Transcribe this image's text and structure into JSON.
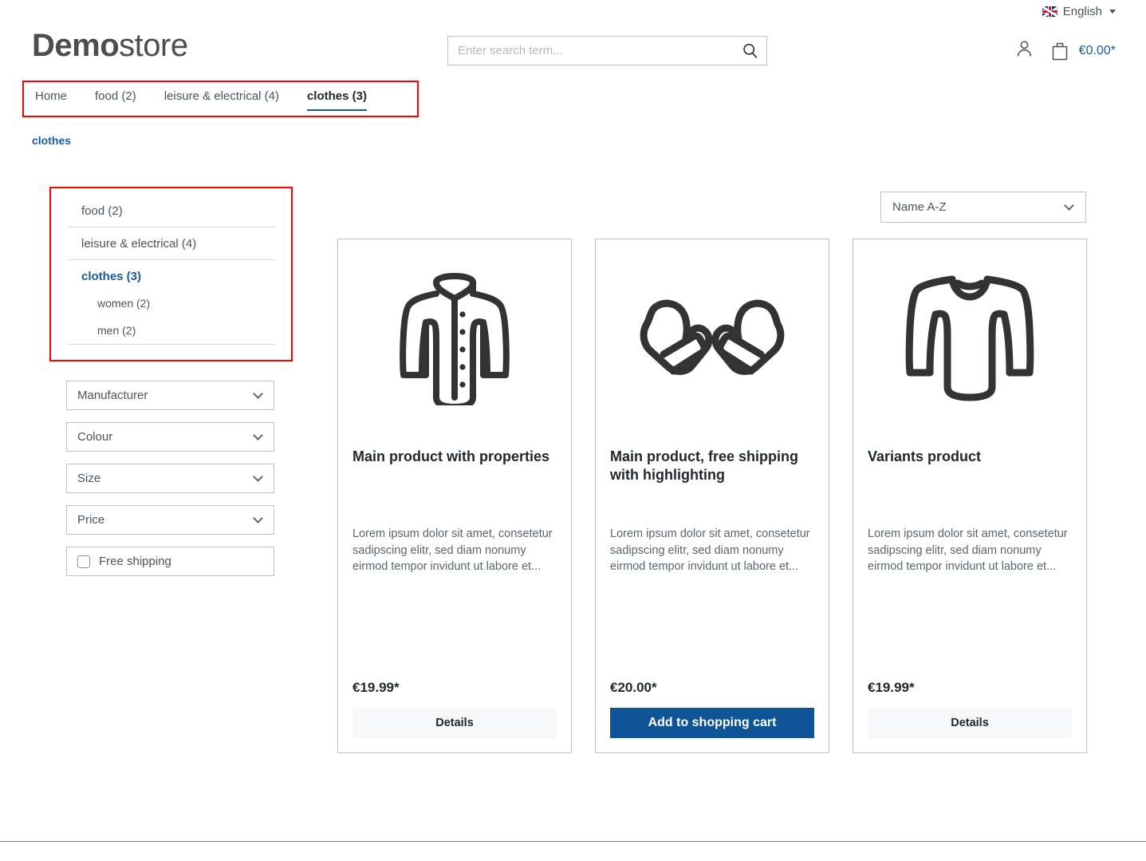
{
  "topbar": {
    "flag_icon": "uk-flag-icon",
    "language": "English",
    "caret_icon": "chevron-down-icon"
  },
  "header": {
    "logo_bold": "Demo",
    "logo_light": "store",
    "search": {
      "placeholder": "Enter search term...",
      "value": "",
      "icon": "search-icon"
    },
    "account_icon": "user-icon",
    "cart_icon": "shopping-bag-icon",
    "cart_total": "€0.00*"
  },
  "mainnav": {
    "items": [
      {
        "label": "Home",
        "active": false
      },
      {
        "label": "food (2)",
        "active": false
      },
      {
        "label": "leisure & electrical (4)",
        "active": false
      },
      {
        "label": "clothes (3)",
        "active": true
      }
    ]
  },
  "breadcrumb": {
    "label": "clothes"
  },
  "sidebar": {
    "categories": [
      {
        "label": "food (2)",
        "level": "top",
        "active": false
      },
      {
        "label": "leisure & electrical (4)",
        "level": "top",
        "active": false
      },
      {
        "label": "clothes (3)",
        "level": "top",
        "active": true
      },
      {
        "label": "women (2)",
        "level": "sub",
        "active": false
      },
      {
        "label": "men (2)",
        "level": "sub",
        "active": false
      }
    ],
    "filters": [
      {
        "label": "Manufacturer",
        "icon": "chevron-down-icon"
      },
      {
        "label": "Colour",
        "icon": "chevron-down-icon"
      },
      {
        "label": "Size",
        "icon": "chevron-down-icon"
      },
      {
        "label": "Price",
        "icon": "chevron-down-icon"
      }
    ],
    "free_shipping": {
      "label": "Free shipping",
      "checked": false
    }
  },
  "sort": {
    "value": "Name A-Z",
    "icon": "chevron-down-icon"
  },
  "products": [
    {
      "image_icon": "jacket-icon",
      "title": "Main product with properties",
      "description": "Lorem ipsum dolor sit amet, consetetur sadipscing elitr, sed diam nonumy eirmod tempor invidunt ut labore et...",
      "price": "€19.99*",
      "button_label": "Details",
      "button_style": "secondary"
    },
    {
      "image_icon": "mittens-icon",
      "title": "Main product, free shipping with highlighting",
      "description": "Lorem ipsum dolor sit amet, consetetur sadipscing elitr, sed diam nonumy eirmod tempor invidunt ut labore et...",
      "price": "€20.00*",
      "button_label": "Add to shopping cart",
      "button_style": "primary"
    },
    {
      "image_icon": "sweater-icon",
      "title": "Variants product",
      "description": "Lorem ipsum dolor sit amet, consetetur sadipscing elitr, sed diam nonumy eirmod tempor invidunt ut labore et...",
      "price": "€19.99*",
      "button_label": "Details",
      "button_style": "secondary"
    }
  ],
  "colors": {
    "accent_blue": "#1a5a9e",
    "button_blue": "#0e5496",
    "highlight_red": "#ff0000",
    "text": "#4a545b",
    "border": "#bcc1c7"
  }
}
